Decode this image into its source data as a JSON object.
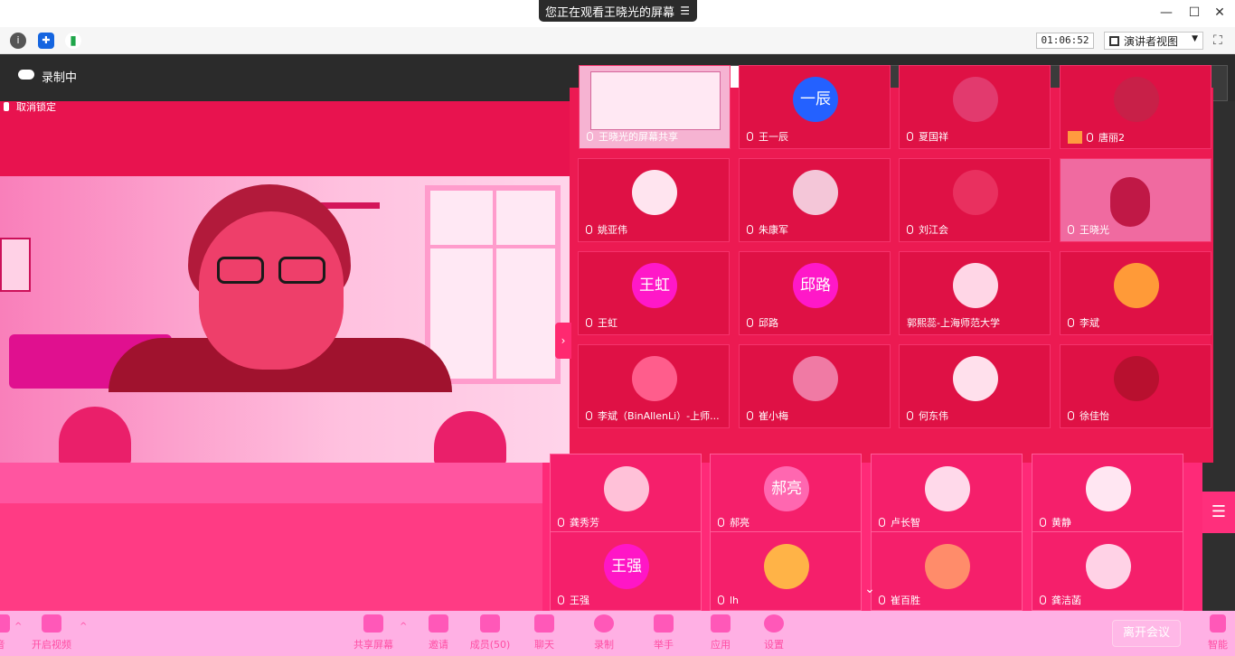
{
  "titlebar": {
    "sharing_banner": "您正在观看王晓光的屏幕",
    "menu_glyph": "☰",
    "minimize_glyph": "—",
    "maximize_glyph": "☐",
    "close_glyph": "✕"
  },
  "toolstrip": {
    "info_glyph": "i",
    "shield_glyph": "✚",
    "signal_glyph": "▮",
    "timer": "01:06:52",
    "view_mode": "演讲者视图",
    "view_caret": "▼",
    "fullscreen_glyph": "⛶"
  },
  "recording": {
    "label": "录制中"
  },
  "unlock": {
    "label": "取消锁定"
  },
  "participants": [
    {
      "name": "王晓光的屏幕共享",
      "avatar": "screen"
    },
    {
      "name": "王一辰",
      "avatar": "text",
      "avatar_text": "一辰"
    },
    {
      "name": "夏国祥",
      "avatar": "photo"
    },
    {
      "name": "唐丽2",
      "avatar": "photo"
    },
    {
      "name": "姚亚伟",
      "avatar": "photo"
    },
    {
      "name": "朱康军",
      "avatar": "photo"
    },
    {
      "name": "刘江会",
      "avatar": "photo"
    },
    {
      "name": "王晓光",
      "avatar": "video"
    },
    {
      "name": "王虹",
      "avatar": "text",
      "avatar_text": "王虹"
    },
    {
      "name": "邱路",
      "avatar": "text",
      "avatar_text": "邱路"
    },
    {
      "name": "郭熙蕊-上海师范大学",
      "avatar": "photo"
    },
    {
      "name": "李斌",
      "avatar": "photo"
    },
    {
      "name": "李斌（BinAllenLi）-上师...",
      "avatar": "photo"
    },
    {
      "name": "崔小梅",
      "avatar": "photo"
    },
    {
      "name": "何东伟",
      "avatar": "photo"
    },
    {
      "name": "徐佳怡",
      "avatar": "photo"
    }
  ],
  "participants_lower": [
    {
      "name": "龚秀芳",
      "avatar": "photo"
    },
    {
      "name": "郝亮",
      "avatar": "text",
      "avatar_text": "郝亮"
    },
    {
      "name": "卢长智",
      "avatar": "photo"
    },
    {
      "name": "黄静",
      "avatar": "photo"
    },
    {
      "name": "王强",
      "avatar": "text",
      "avatar_text": "王强"
    },
    {
      "name": "lh",
      "avatar": "photo"
    },
    {
      "name": "崔百胜",
      "avatar": "photo"
    },
    {
      "name": "龚洁菡",
      "avatar": "photo"
    }
  ],
  "controls": {
    "collapse_glyph": "›",
    "list_glyph": "☰",
    "scroll_down_glyph": "⌄",
    "caret_up_glyph": "^"
  },
  "toolbar": {
    "mute": "音",
    "video": "开启视频",
    "share": "共享屏幕",
    "invite": "邀请",
    "members": "成员(50)",
    "chat": "聊天",
    "record": "录制",
    "raise_hand": "举手",
    "apps": "应用",
    "settings": "设置",
    "leave": "离开会议",
    "meeting_mini": "智能"
  }
}
